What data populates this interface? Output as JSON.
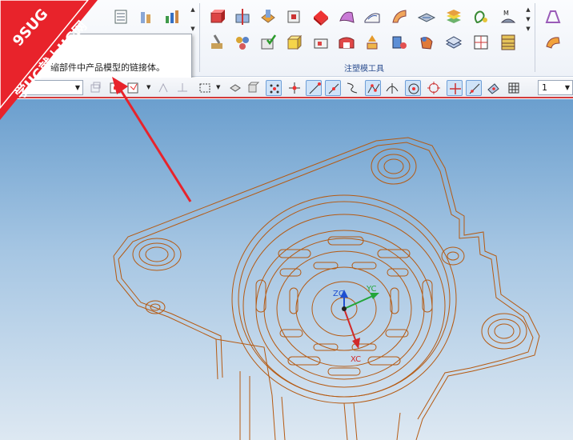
{
  "ribbon": {
    "group_label": "注塑模工具"
  },
  "tooltip": {
    "text": "缩部件中产品模型的链接体。"
  },
  "toolbar": {
    "filter_value": "",
    "scale_value": "1"
  },
  "viewport": {
    "axes": {
      "zc": "ZC",
      "yc": "YC",
      "xc": "XC"
    }
  },
  "watermark": {
    "line1": "9SUG",
    "line2": "学UG就上UG网",
    "color": "#e8232b"
  },
  "colors": {
    "model_edges": "#b55a12",
    "highlight_bar": "#d33b3b",
    "group_label": "#2a4d8f"
  }
}
